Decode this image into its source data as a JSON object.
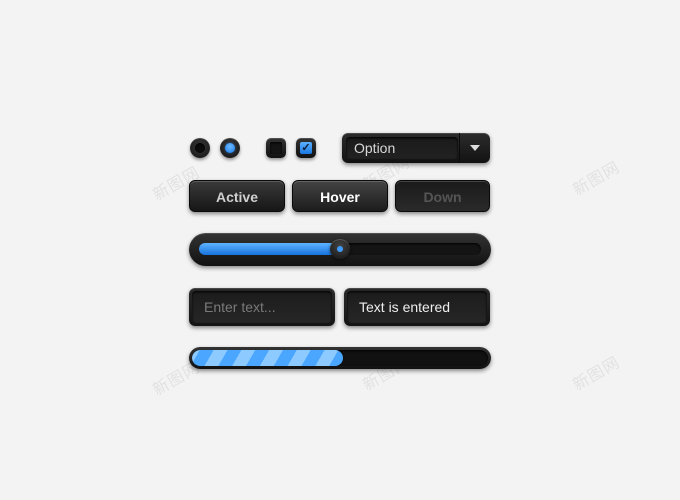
{
  "watermark": "新图网",
  "radios": [
    {
      "name": "radio-unchecked",
      "checked": false
    },
    {
      "name": "radio-checked",
      "checked": true
    }
  ],
  "checkboxes": [
    {
      "name": "checkbox-unchecked",
      "checked": false
    },
    {
      "name": "checkbox-checked",
      "checked": true,
      "glyph": "✓"
    }
  ],
  "dropdown": {
    "value": "Option",
    "icon": "chevron-down-icon"
  },
  "buttons": {
    "active_label": "Active",
    "hover_label": "Hover",
    "down_label": "Down"
  },
  "slider": {
    "value_percent": 50
  },
  "inputs": {
    "empty_placeholder": "Enter text...",
    "filled_value": "Text is entered"
  },
  "progress": {
    "value_percent": 51
  },
  "colors": {
    "accent": "#1a7de8",
    "background": "#f3f3f3",
    "control": "#1a1a1a"
  }
}
